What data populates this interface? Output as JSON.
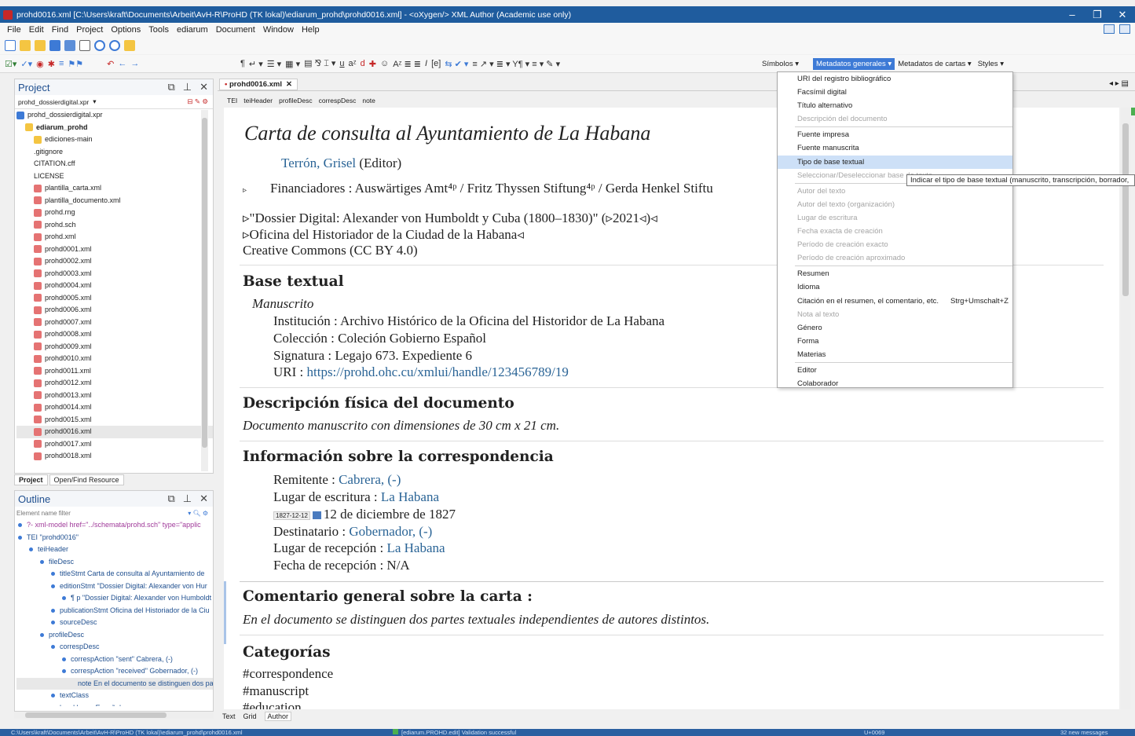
{
  "window": {
    "title": "prohd0016.xml [C:\\Users\\kraft\\Documents\\Arbeit\\AvH-R\\ProHD (TK lokal)\\ediarum_prohd\\prohd0016.xml] - <oXygen/> XML Author (Academic use only)",
    "min": "–",
    "max": "❐",
    "close": "✕"
  },
  "menubar": [
    "File",
    "Edit",
    "Find",
    "Project",
    "Options",
    "Tools",
    "ediarum",
    "Document",
    "Window",
    "Help"
  ],
  "toolbar2": {
    "simbolos": "Símbolos",
    "metadatos_generales": "Metadatos generales",
    "metadatos_cartas": "Metadatos de cartas",
    "styles": "Styles"
  },
  "project": {
    "title": "Project",
    "file": "prohd_dossierdigital.xpr",
    "tree": [
      {
        "label": "prohd_dossierdigital.xpr",
        "type": "proj",
        "indent": 0
      },
      {
        "label": "ediarum_prohd",
        "type": "folder",
        "indent": 1,
        "bold": true
      },
      {
        "label": "ediciones-main",
        "type": "folder",
        "indent": 2
      },
      {
        "label": ".gitignore",
        "type": "doc",
        "indent": 2
      },
      {
        "label": "CITATION.cff",
        "type": "doc",
        "indent": 2
      },
      {
        "label": "LICENSE",
        "type": "doc",
        "indent": 2
      },
      {
        "label": "plantilla_carta.xml",
        "type": "xml",
        "indent": 2
      },
      {
        "label": "plantilla_documento.xml",
        "type": "xml",
        "indent": 2
      },
      {
        "label": "prohd.rng",
        "type": "xml",
        "indent": 2
      },
      {
        "label": "prohd.sch",
        "type": "xml",
        "indent": 2
      },
      {
        "label": "prohd.xml",
        "type": "xml",
        "indent": 2
      },
      {
        "label": "prohd0001.xml",
        "type": "xml",
        "indent": 2
      },
      {
        "label": "prohd0002.xml",
        "type": "xml",
        "indent": 2
      },
      {
        "label": "prohd0003.xml",
        "type": "xml",
        "indent": 2
      },
      {
        "label": "prohd0004.xml",
        "type": "xml",
        "indent": 2
      },
      {
        "label": "prohd0005.xml",
        "type": "xml",
        "indent": 2
      },
      {
        "label": "prohd0006.xml",
        "type": "xml",
        "indent": 2
      },
      {
        "label": "prohd0007.xml",
        "type": "xml",
        "indent": 2
      },
      {
        "label": "prohd0008.xml",
        "type": "xml",
        "indent": 2
      },
      {
        "label": "prohd0009.xml",
        "type": "xml",
        "indent": 2
      },
      {
        "label": "prohd0010.xml",
        "type": "xml",
        "indent": 2
      },
      {
        "label": "prohd0011.xml",
        "type": "xml",
        "indent": 2
      },
      {
        "label": "prohd0012.xml",
        "type": "xml",
        "indent": 2
      },
      {
        "label": "prohd0013.xml",
        "type": "xml",
        "indent": 2
      },
      {
        "label": "prohd0014.xml",
        "type": "xml",
        "indent": 2
      },
      {
        "label": "prohd0015.xml",
        "type": "xml",
        "indent": 2
      },
      {
        "label": "prohd0016.xml",
        "type": "xml",
        "indent": 2,
        "selected": true
      },
      {
        "label": "prohd0017.xml",
        "type": "xml",
        "indent": 2
      },
      {
        "label": "prohd0018.xml",
        "type": "xml",
        "indent": 2
      }
    ],
    "tab_project": "Project",
    "tab_open": "Open/Find Resource"
  },
  "outline": {
    "title": "Outline",
    "filter_placeholder": "Element name filter",
    "rows": [
      {
        "label": "?- xml-model href=\"../schemata/prohd.sch\" type=\"applic",
        "indent": 0,
        "pi": true
      },
      {
        "label": "TEI  \"prohd0016\"",
        "indent": 0
      },
      {
        "label": "teiHeader",
        "indent": 1
      },
      {
        "label": "fileDesc",
        "indent": 2
      },
      {
        "label": "titleStmt  Carta de consulta al Ayuntamiento de",
        "indent": 3
      },
      {
        "label": "editionStmt  \"Dossier Digital: Alexander von Hur",
        "indent": 3
      },
      {
        "label": "¶  p  \"Dossier Digital: Alexander von Humboldt",
        "indent": 4
      },
      {
        "label": "publicationStmt  Oficina del Historiador de la Ciu",
        "indent": 3
      },
      {
        "label": "sourceDesc",
        "indent": 3
      },
      {
        "label": "profileDesc",
        "indent": 2
      },
      {
        "label": "correspDesc",
        "indent": 3
      },
      {
        "label": "correspAction  \"sent\"  Cabrera, (-)",
        "indent": 4
      },
      {
        "label": "correspAction  \"received\"  Gobernador, (-)",
        "indent": 4
      },
      {
        "label": "note  En el documento se distinguen dos pa",
        "indent": 5,
        "selected": true
      },
      {
        "label": "textClass",
        "indent": 3
      },
      {
        "label": "langUsage  Español",
        "indent": 3
      }
    ]
  },
  "editor": {
    "tab": "prohd0016.xml",
    "crumbs": [
      "TEI",
      "teiHeader",
      "profileDesc",
      "correspDesc",
      "note"
    ],
    "title": "Carta de consulta al Ayuntamiento de La Habana",
    "editor_name": "Terrón, Grisel",
    "editor_role": "(Editor)",
    "financiadores": "Financiadores : Auswärtiges Amt⁴ᵖ / Fritz Thyssen Stiftung⁴ᵖ / Gerda Henkel Stiftu",
    "dossier": "▹\"Dossier Digital: Alexander von Humboldt y Cuba (1800–1830)\" (▹2021◃)◃",
    "oficina": "▹Oficina del Historiador de la Ciudad de la Habana◃",
    "license": "Creative Commons (CC BY 4.0)",
    "h_base": "Base textual",
    "manuscrito": "Manuscrito",
    "institucion": "Institución : Archivo Histórico de la Oficina del Historidor de La Habana",
    "coleccion": "Colección : Coleción Gobierno Español",
    "signatura": "Signatura : Legajo 673. Expediente 6",
    "uri_label": "URI : ",
    "uri": "https://prohd.ohc.cu/xmlui/handle/123456789/19",
    "h_desc": "Descripción física del documento",
    "desc": "Documento manuscrito con dimensiones de 30 cm x 21 cm.",
    "h_info": "Información sobre la correspondencia",
    "remitente_label": "Remitente : ",
    "remitente": "Cabrera, (-)",
    "lugar_esc_label": "Lugar de escritura : ",
    "lugar_esc": "La Habana",
    "date_badge": "1827-12-12",
    "date_text": "12 de diciembre de 1827",
    "dest_label": "Destinatario : ",
    "dest": "Gobernador, (-)",
    "lugar_rec_label": "Lugar de recepción : ",
    "lugar_rec": "La Habana",
    "fecha_rec": "Fecha de recepción : N/A",
    "h_coment": "Comentario general sobre la carta :",
    "coment": "En el documento se distinguen dos partes textuales independientes de autores distintos.",
    "h_cat": "Categorías",
    "cat1": "#correspondence",
    "cat2": "#manuscript",
    "cat3": "#education"
  },
  "bottom_tabs": [
    "Text",
    "Grid",
    "Author"
  ],
  "menu": {
    "items": [
      {
        "label": "URI del registro bibliográfico"
      },
      {
        "label": "Facsímil digital"
      },
      {
        "label": "Título alternativo"
      },
      {
        "label": "Descripción del documento",
        "disabled": true
      },
      {
        "sep": true
      },
      {
        "label": "Fuente impresa"
      },
      {
        "label": "Fuente manuscrita"
      },
      {
        "label": "Tipo de base textual",
        "highlight": true
      },
      {
        "label": "Seleccionar/Deseleccionar base de texto",
        "disabled": true
      },
      {
        "sep": true
      },
      {
        "label": "Autor del texto",
        "disabled": true
      },
      {
        "label": "Autor del texto (organización)",
        "disabled": true
      },
      {
        "label": "Lugar de escritura",
        "disabled": true
      },
      {
        "label": "Fecha exacta de creación",
        "disabled": true
      },
      {
        "label": "Período de creación exacto",
        "disabled": true
      },
      {
        "label": "Período de creación aproximado",
        "disabled": true
      },
      {
        "sep": true
      },
      {
        "label": "Resumen"
      },
      {
        "label": "Idioma"
      },
      {
        "label": "Citación en el resumen, el comentario, etc.",
        "shortcut": "Strg+Umschalt+Z"
      },
      {
        "label": "Nota al texto",
        "disabled": true
      },
      {
        "label": "Género"
      },
      {
        "label": "Forma"
      },
      {
        "label": "Materias"
      },
      {
        "sep": true
      },
      {
        "label": "Editor"
      },
      {
        "label": "Colaborador"
      }
    ]
  },
  "tooltip": "Indicar el tipo de base textual (manuscrito, transcripción, borrador,",
  "status": {
    "path": "C:\\Users\\kraft\\Documents\\Arbeit\\AvH-R\\ProHD (TK lokal)\\ediarum_prohd\\prohd0016.xml",
    "validation": "[ediarum.PROHD.edit] Validation successful",
    "unicode": "U+0069",
    "messages": "32 new messages"
  },
  "colors": {
    "titlebar": "#1f5c9e",
    "accent": "#3d7ad6",
    "link": "#2a6496",
    "menu_highlight": "#cde0f7"
  }
}
